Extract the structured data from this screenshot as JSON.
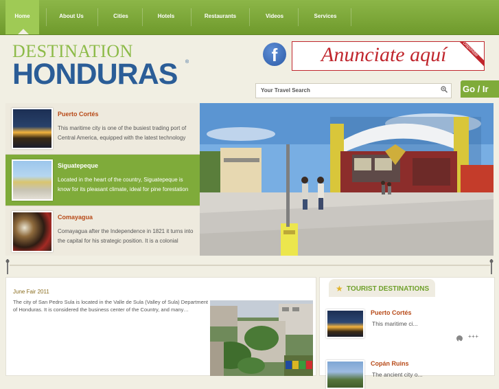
{
  "nav": {
    "items": [
      {
        "label": "Home",
        "active": true
      },
      {
        "label": "About Us"
      },
      {
        "label": "Cities"
      },
      {
        "label": "Hotels"
      },
      {
        "label": "Restaurants"
      },
      {
        "label": "Videos"
      },
      {
        "label": "Services"
      }
    ]
  },
  "logo": {
    "line1": "DESTINATION",
    "line2": "HONDURAS",
    "reg": "®"
  },
  "facebook": {
    "glyph": "f"
  },
  "ad": {
    "text": "Anunciate aquí",
    "corner": "Disponible"
  },
  "search": {
    "placeholder": "Your Travel Search",
    "go_label": "Go / Ir"
  },
  "slider": {
    "slides": [
      {
        "title": "Puerto Cortés",
        "desc": "This maritime city is one of the busiest trading port of Central America, equipped with the latest technology"
      },
      {
        "title": "Siguatepeque",
        "desc": "Located in the heart of the country, Siguatepeque is know for its pleasant climate, ideal for pine forestation",
        "active": true
      },
      {
        "title": "Comayagua",
        "desc": "Comayagua after the Independence in 1821 it turns into the capital for his strategic position. It is a colonial"
      }
    ]
  },
  "news": {
    "date": "June Fair 2011",
    "text": "The city of San Pedro Sula is located in the Valle de Sula (Valley of Sula) Department of Honduras. It is considered the business center of the Country, and many…"
  },
  "tourist": {
    "title": "TOURIST DESTINATIONS",
    "items": [
      {
        "name": "Puerto Cortés",
        "desc": "This maritime ci...",
        "more": "+++"
      },
      {
        "name": "Copán Ruins",
        "desc": "The ancient city o..."
      }
    ]
  },
  "colors": {
    "nav_green": "#7fab3a",
    "brand_blue": "#2b5d97",
    "accent_orange": "#b74917",
    "ad_red": "#c0262d"
  }
}
